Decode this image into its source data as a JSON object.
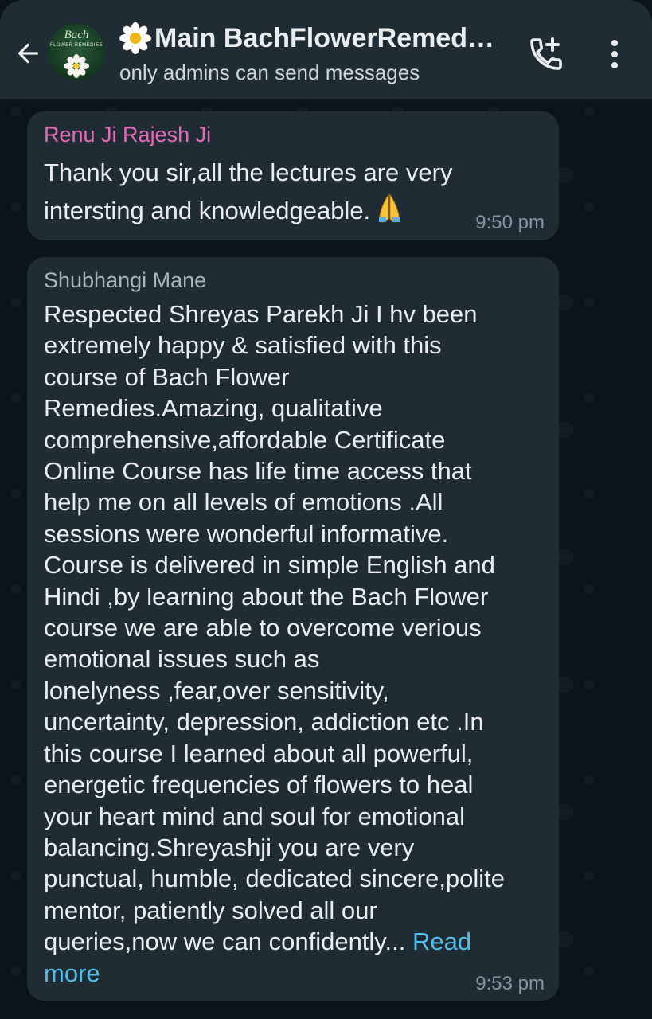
{
  "header": {
    "title": "Main BachFlowerRemed…",
    "subtitle": "only admins can send messages",
    "avatar_brand_line1": "Bach",
    "avatar_brand_line2": "FLOWER REMEDIES"
  },
  "icons": {
    "back": "arrow-back-icon",
    "title_emoji": "daisy-flower-emoji",
    "call": "add-call-icon",
    "menu": "more-vert-icon",
    "reaction": "folded-hands-emoji"
  },
  "messages": [
    {
      "sender": "Renu Ji Rajesh Ji",
      "text": "Thank you  sir,all the lectures are very\nintersting and knowledgeable.",
      "time": "9:50 pm"
    },
    {
      "sender": "Shubhangi Mane",
      "text": "Respected Shreyas Parekh Ji I hv been\nextremely happy & satisfied with this\ncourse of Bach Flower\nRemedies.Amazing, qualitative\ncomprehensive,affordable Certificate\nOnline Course has life time access that\nhelp me on all levels of emotions .All\nsessions were wonderful informative.\nCourse is delivered in simple English and\nHindi ,by learning about the Bach Flower\ncourse we are able to overcome verious\nemotional issues such as\nlonelyness ,fear,over sensitivity,\nuncertainty, depression, addiction etc .In\nthis course I learned about all powerful,\nenergetic frequencies of flowers to heal\nyour heart mind and soul for emotional\nbalancing.Shreyashji you are very\npunctual, humble, dedicated sincere,polite\nmentor, patiently solved all our\nqueries,now we can confidently... ",
      "read_more": "Read\nmore",
      "time": "9:53 pm"
    }
  ],
  "colors": {
    "header_bg": "#1f2c34",
    "chat_bg": "#0b141a",
    "bubble_bg": "#202c33",
    "sender1_color": "#e26ab6",
    "link_color": "#53bdeb"
  }
}
